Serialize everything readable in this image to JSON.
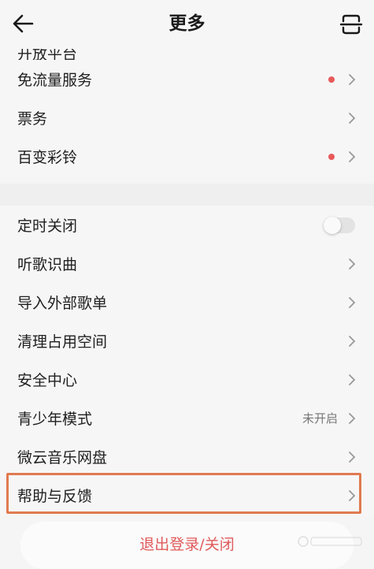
{
  "header": {
    "title": "更多",
    "back_icon": "arrow-left-icon",
    "scan_icon": "scan-icon"
  },
  "partial_row": {
    "label": "开放平台"
  },
  "group1": [
    {
      "label": "免流量服务",
      "dot": true
    },
    {
      "label": "票务",
      "dot": false
    },
    {
      "label": "百变彩铃",
      "dot": true
    }
  ],
  "group2": [
    {
      "label": "定时关闭",
      "control": "toggle",
      "toggle_on": false
    },
    {
      "label": "听歌识曲"
    },
    {
      "label": "导入外部歌单"
    },
    {
      "label": "清理占用空间"
    },
    {
      "label": "安全中心"
    },
    {
      "label": "青少年模式",
      "value": "未开启"
    },
    {
      "label": "微云音乐网盘"
    },
    {
      "label": "帮助与反馈",
      "highlighted": true
    }
  ],
  "logout": {
    "label": "退出登录/关闭"
  },
  "colors": {
    "accent_red": "#e05a5a",
    "highlight_border": "#e07a50",
    "background": "#f6f6f6"
  }
}
